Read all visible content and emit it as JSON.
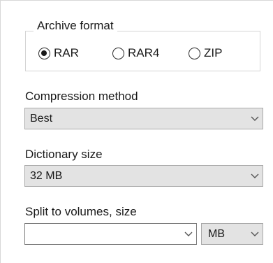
{
  "archive_format": {
    "title": "Archive format",
    "options": [
      {
        "label": "RAR",
        "checked": true
      },
      {
        "label": "RAR4",
        "checked": false
      },
      {
        "label": "ZIP",
        "checked": false
      }
    ]
  },
  "compression_method": {
    "label": "Compression method",
    "value": "Best"
  },
  "dictionary_size": {
    "label": "Dictionary size",
    "value": "32 MB"
  },
  "split_volumes": {
    "label": "Split to volumes, size",
    "value": "",
    "unit": "MB"
  },
  "icons": {
    "dropdown": "chevron-down-icon"
  }
}
